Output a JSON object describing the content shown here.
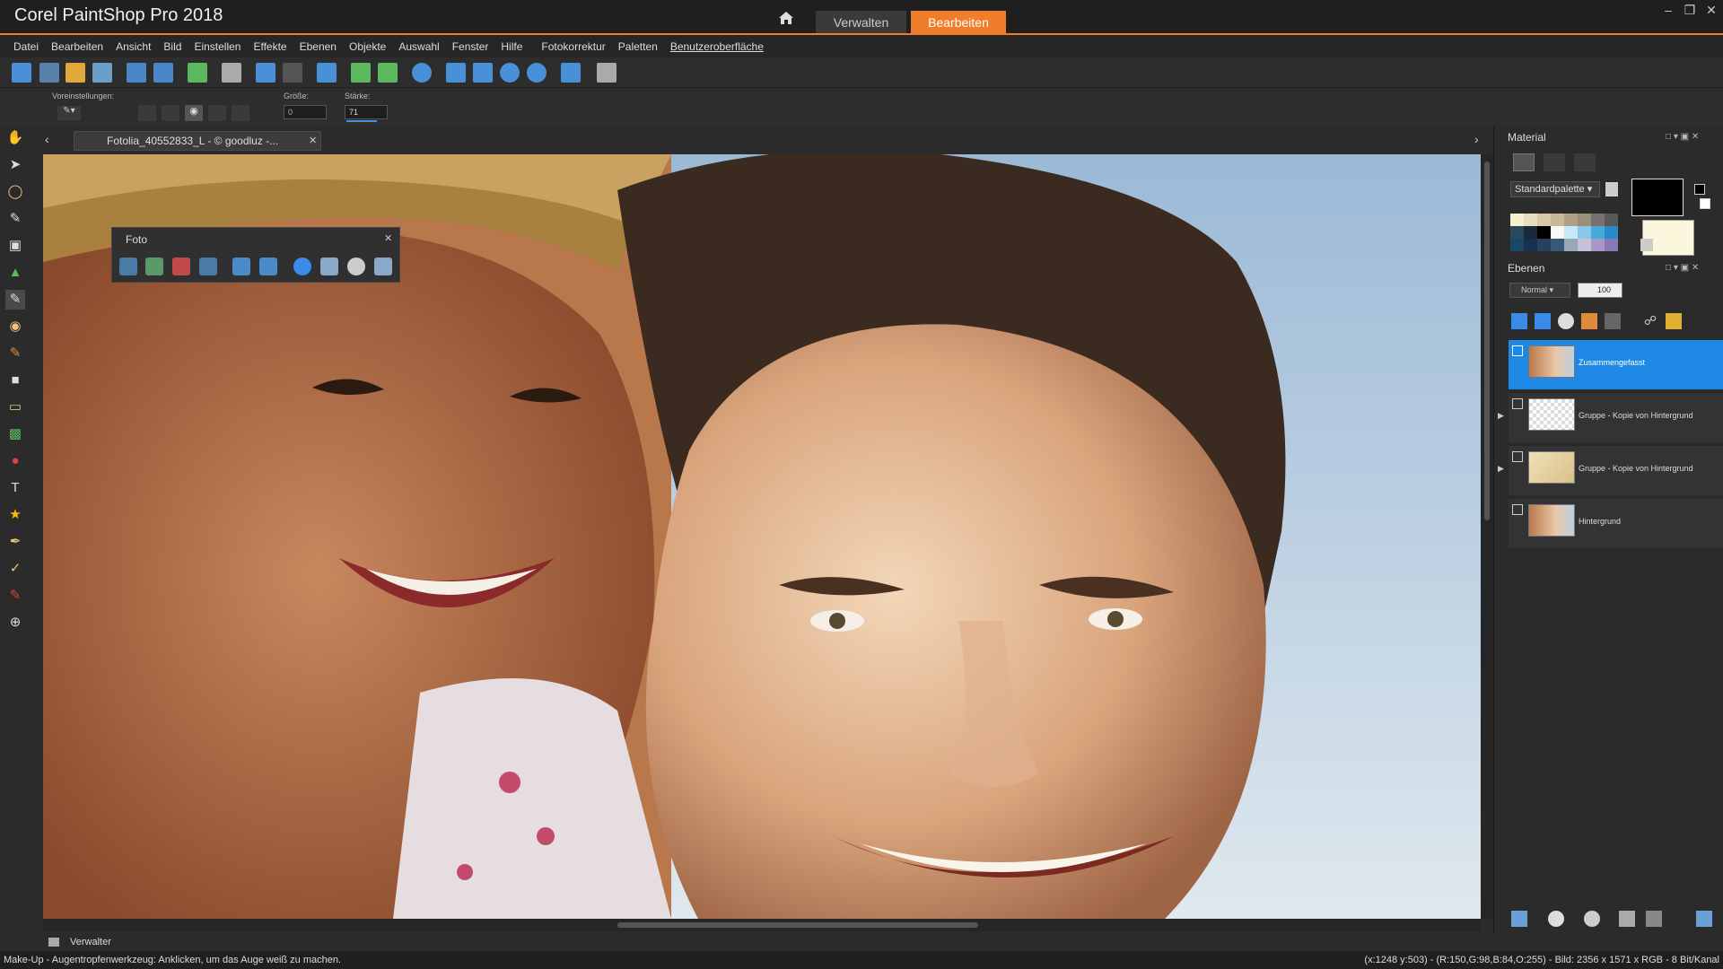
{
  "app": {
    "title": "Corel PaintShop Pro 2018"
  },
  "workspace_tabs": {
    "manage": "Verwalten",
    "edit": "Bearbeiten"
  },
  "menu": [
    "Datei",
    "Bearbeiten",
    "Ansicht",
    "Bild",
    "Einstellen",
    "Effekte",
    "Ebenen",
    "Objekte",
    "Auswahl",
    "Fenster",
    "Hilfe",
    "Fotokorrektur",
    "Paletten",
    "Benutzeroberfläche"
  ],
  "options": {
    "presets_label": "Voreinstellungen:",
    "size_label": "Größe:",
    "size_value": "0",
    "strength_label": "Stärke:",
    "strength_value": "71"
  },
  "document": {
    "tab_label": "Fotolia_40552833_L - © goodluz -..."
  },
  "foto_panel": {
    "title": "Foto"
  },
  "material": {
    "title": "Material",
    "palette_select": "Standardpalette",
    "colors": {
      "foreground": "#000000",
      "background": "#fbf7dc"
    }
  },
  "layers_panel": {
    "title": "Ebenen",
    "blend_mode": "Normal",
    "opacity": "100",
    "layers": [
      {
        "name": "Zusammengefasst",
        "selected": true
      },
      {
        "name": "Gruppe - Kopie von Hintergrund",
        "selected": false
      },
      {
        "name": "Gruppe - Kopie von Hintergrund",
        "selected": false
      },
      {
        "name": "Hintergrund",
        "selected": false
      }
    ]
  },
  "bottom": {
    "manager_tab": "Verwalter"
  },
  "status": {
    "hint": "Make-Up - Augentropfenwerkzeug: Anklicken, um das Auge weiß zu machen.",
    "info": "(x:1248 y:503) - (R:150,G:98,B:84,O:255) - Bild: 2356 x 1571 x RGB - 8 Bit/Kanal"
  },
  "accent_color": "#f07d2a",
  "selection_color": "#1e88e5"
}
